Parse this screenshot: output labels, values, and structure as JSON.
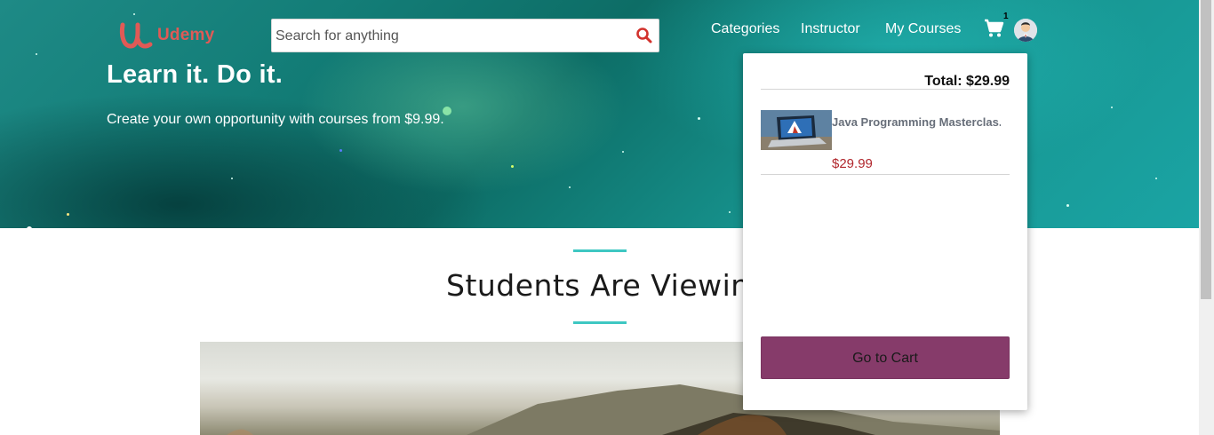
{
  "header": {
    "logo_text": "Udemy",
    "search": {
      "placeholder": "Search for anything",
      "value": ""
    },
    "nav": [
      "Categories",
      "Instructor",
      "My Courses"
    ],
    "cart_count": "1"
  },
  "hero": {
    "title": "Learn it. Do it.",
    "subtitle": "Create your own opportunity with courses from $9.99."
  },
  "section": {
    "title": "Students Are Viewing"
  },
  "cart_dropdown": {
    "total": "Total: $29.99",
    "items": [
      {
        "title": "Java Programming Masterclas...",
        "price": "$29.99"
      }
    ],
    "go_to_cart": "Go to Cart"
  },
  "colors": {
    "accent": "#3ec7c2",
    "brand": "#e05a56",
    "cart_button": "#863b6a",
    "price": "#b1272d"
  },
  "icons": [
    "udemy-logo-icon",
    "search-icon",
    "cart-icon",
    "avatar-icon"
  ]
}
